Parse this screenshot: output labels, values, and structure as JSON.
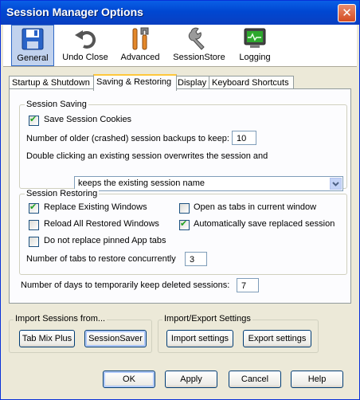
{
  "window": {
    "title": "Session Manager Options",
    "close_glyph": "✕"
  },
  "toolbar": [
    {
      "label": "General",
      "icon": "floppy-disk-icon",
      "selected": true
    },
    {
      "label": "Undo Close",
      "icon": "undo-arrow-icon"
    },
    {
      "label": "Advanced",
      "icon": "tools-icon"
    },
    {
      "label": "SessionStore",
      "icon": "wrench-icon"
    },
    {
      "label": "Logging",
      "icon": "monitor-icon"
    }
  ],
  "tabs": [
    {
      "label": "Startup & Shutdown"
    },
    {
      "label": "Saving & Restoring",
      "active": true
    },
    {
      "label": "Display"
    },
    {
      "label": "Keyboard Shortcuts"
    }
  ],
  "session_saving": {
    "title": "Session Saving",
    "save_cookies_label": "Save Session Cookies",
    "save_cookies_checked": true,
    "backups_label": "Number of older (crashed) session backups to keep:",
    "backups_value": "10",
    "dblclick_label": "Double clicking an existing session overwrites the session and",
    "dblclick_value": "keeps the existing session name"
  },
  "session_restoring": {
    "title": "Session Restoring",
    "replace_windows_label": "Replace Existing Windows",
    "replace_windows_checked": true,
    "open_as_tabs_label": "Open as tabs in current window",
    "open_as_tabs_checked": false,
    "reload_label": "Reload All Restored Windows",
    "reload_checked": false,
    "auto_save_label": "Automatically save replaced session",
    "auto_save_checked": true,
    "pinned_label": "Do not replace pinned App tabs",
    "pinned_checked": false,
    "concurrent_label": "Number of tabs to restore concurrently",
    "concurrent_value": "3"
  },
  "deleted_days_label": "Number of days to temporarily keep deleted sessions:",
  "deleted_days_value": "7",
  "import_group": {
    "title": "Import Sessions from...",
    "tab_mix_plus": "Tab Mix Plus",
    "session_saver": "SessionSaver"
  },
  "import_export_group": {
    "title": "Import/Export Settings",
    "import_settings": "Import settings",
    "export_settings": "Export settings"
  },
  "buttons": {
    "ok": "OK",
    "apply": "Apply",
    "cancel": "Cancel",
    "help": "Help"
  },
  "colors": {
    "titlebar": "#0a5fe6",
    "check": "#21a121",
    "tab_highlight": "#ffc83c"
  }
}
